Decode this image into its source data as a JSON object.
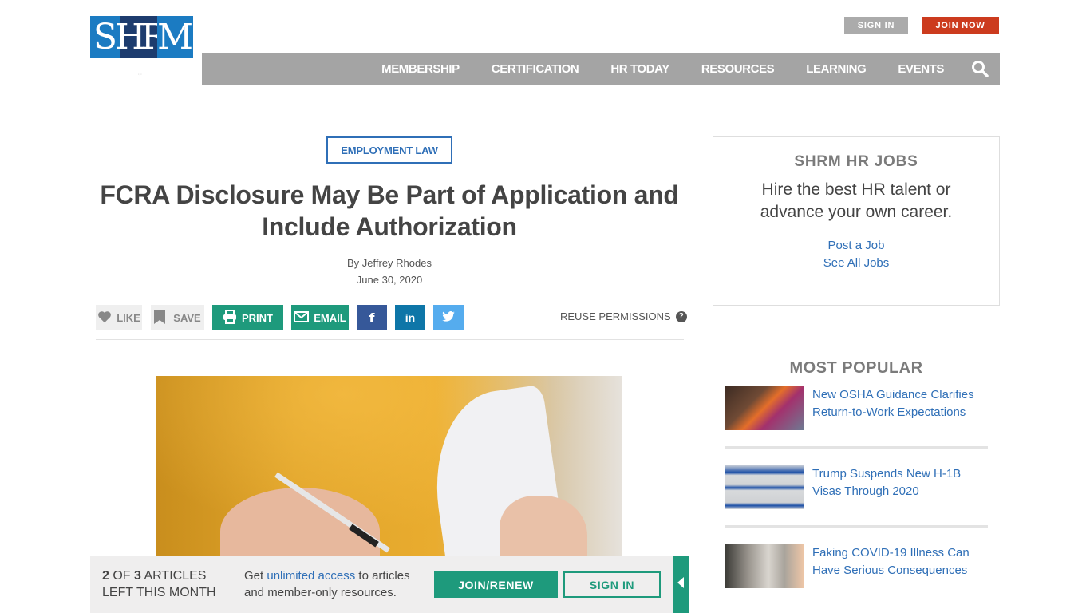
{
  "header": {
    "logo": {
      "s": "S",
      "hr": "HR",
      "m": "M",
      "alt": "SHRM"
    },
    "sign_in": "SIGN IN",
    "join_now": "JOIN NOW",
    "nav": [
      "MEMBERSHIP",
      "CERTIFICATION",
      "HR TODAY",
      "RESOURCES",
      "LEARNING",
      "EVENTS"
    ],
    "search_icon": "search-icon"
  },
  "article": {
    "category": "EMPLOYMENT LAW",
    "title": "FCRA Disclosure May Be Part of Application and Include Authorization",
    "author": "By Jeffrey Rhodes",
    "date": "June 30, 2020",
    "share": {
      "like": "LIKE",
      "save": "SAVE",
      "print": "PRINT",
      "email": "EMAIL",
      "facebook_glyph": "f",
      "linkedin_glyph": "in",
      "reuse": "REUSE PERMISSIONS",
      "help_glyph": "?"
    },
    "image_alt": "Person in yellow shirt signing a document"
  },
  "sidebar": {
    "jobs": {
      "title": "SHRM HR JOBS",
      "pitch": "Hire the best HR talent or advance your own career.",
      "links": [
        "Post a Job",
        "See All Jobs"
      ]
    },
    "most_popular": {
      "title": "MOST POPULAR",
      "items": [
        {
          "title": "New OSHA Guidance Clarifies Return-to-Work Expectations"
        },
        {
          "title": "Trump Suspends New H-1B Visas Through 2020"
        },
        {
          "title": "Faking COVID-19 Illness Can Have Serious Consequences"
        }
      ]
    }
  },
  "meter": {
    "used": "2",
    "of_text": " OF ",
    "total": "3",
    "suffix_line1": " ARTICLES",
    "line2": "LEFT THIS MONTH",
    "pitch_pre": "Get ",
    "pitch_link": "unlimited access",
    "pitch_post": " to articles and member-only resources.",
    "join_renew": "JOIN/RENEW",
    "sign_in": "SIGN IN"
  },
  "colors": {
    "brand_blue": "#1b7bc2",
    "brand_navy": "#1d3c6e",
    "accent_green": "#1e9a7c",
    "join_red": "#cc3b1e",
    "link_blue": "#2f6fb7",
    "nav_gray": "#a4a4a4"
  }
}
